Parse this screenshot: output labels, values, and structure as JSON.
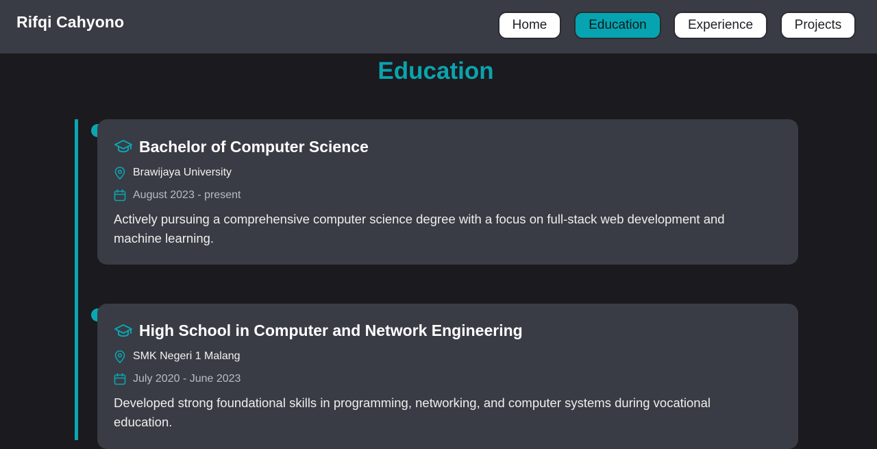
{
  "header": {
    "brand": "Rifqi Cahyono",
    "nav": [
      {
        "label": "Home"
      },
      {
        "label": "Education"
      },
      {
        "label": "Experience"
      },
      {
        "label": "Projects"
      }
    ],
    "active_nav": "Education"
  },
  "page": {
    "title": "Education"
  },
  "education": [
    {
      "degree": "Bachelor of Computer Science",
      "institution": "Brawijaya University",
      "period": "August 2023 - present",
      "description": "Actively pursuing a comprehensive computer science degree with a focus on full-stack web development and machine learning."
    },
    {
      "degree": "High School in Computer and Network Engineering",
      "institution": "SMK Negeri 1 Malang",
      "period": "July 2020 - June 2023",
      "description": "Developed strong foundational skills in programming, networking, and computer systems during vocational education."
    }
  ],
  "icons": {
    "degree": "graduation-cap-icon",
    "institution": "map-pin-icon",
    "period": "calendar-icon"
  },
  "colors": {
    "accent": "#0aa6b2",
    "header_bg": "#393c44",
    "page_bg": "#1b1a1f",
    "card_bg": "#393c44"
  }
}
